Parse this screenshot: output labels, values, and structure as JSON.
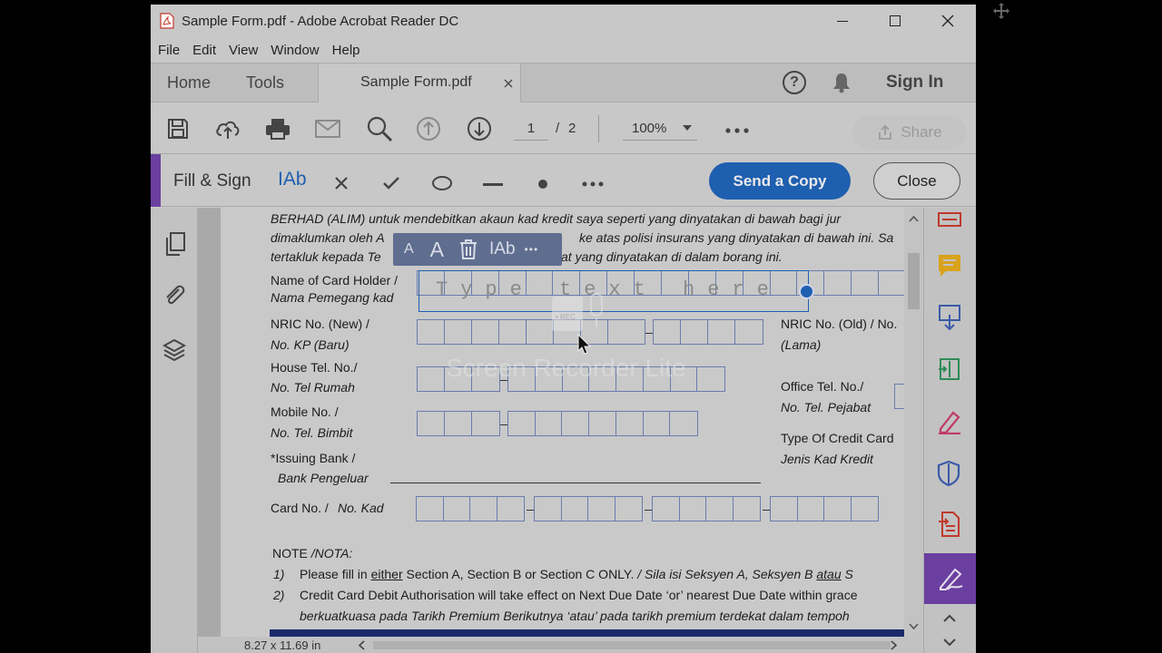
{
  "window": {
    "title": "Sample Form.pdf - Adobe Acrobat Reader DC"
  },
  "menu": [
    "File",
    "Edit",
    "View",
    "Window",
    "Help"
  ],
  "tabs": {
    "home": "Home",
    "tools": "Tools",
    "doc": "Sample Form.pdf",
    "sign_in": "Sign In"
  },
  "toolbar": {
    "page_current": "1",
    "page_sep": "/",
    "page_total": "2",
    "zoom": "100%",
    "share": "Share"
  },
  "fill_sign": {
    "label": "Fill & Sign",
    "text_tool": "IAb",
    "send_copy": "Send a Copy",
    "close": "Close"
  },
  "float_toolbar": {
    "small_a": "A",
    "big_a": "A",
    "text_tool": "IAb",
    "more": "•••"
  },
  "type_field": {
    "placeholder": "Type text here"
  },
  "watermark": {
    "text": "Screen Recorder Lite",
    "badge": "• REC"
  },
  "status": {
    "page_size": "8.27 x 11.69 in"
  },
  "doc": {
    "para_line1": "BERHAD (ALIM) untuk mendebitkan akaun kad kredit saya seperti yang dinyatakan di bawah bagi jur",
    "para_line2a": "dimaklumkan oleh A",
    "para_line2b": "ke atas polisi insurans yang dinyatakan di bawah ini. Sa",
    "para_line3a": "tertakluk kepada Te",
    "para_line3b": "at yang dinyatakan di dalam borang ini.",
    "name_label": "Name  of  Card Holder  /",
    "name_label_my": "Nama Pemegang kad",
    "nric_new": "NRIC No. (New) /",
    "nric_new_my": "No. KP (Baru)",
    "nric_old": "NRIC No. (Old) / No.",
    "nric_old_my": "(Lama)",
    "house_tel": "House Tel. No./",
    "house_tel_my": "No. Tel Rumah",
    "office_tel": "Office Tel. No./",
    "office_tel_my": "No. Tel. Pejabat",
    "mobile": "Mobile No. /",
    "mobile_my": "No. Tel. Bimbit",
    "card_type": "Type Of Credit Card",
    "card_type_my": "Jenis Kad Kredit",
    "issuing_bank": "*Issuing Bank /",
    "issuing_bank_my": "Bank Pengeluar",
    "card_no": "Card No. /",
    "card_no_my": "No. Kad",
    "note": "NOTE",
    "note_my": " /NOTA:",
    "n1_num": "1)",
    "n1_a": "Please fill in ",
    "n1_b": "either",
    "n1_c": " Section A, Section B or Section C ONLY.",
    "n1_d": " / Sila isi Seksyen A, Seksyen B ",
    "n1_e": "atau",
    "n1_f": " S",
    "n2_num": "2)",
    "n2_a": "Credit Card Debit Authorisation will take effect on Next Due Date ‘or’ nearest Due Date within grace",
    "n2_b": "berkuatkuasa pada Tarikh Premium Berikutnya ‘atau’ pada tarikh premium terdekat dalam tempoh"
  },
  "colors": {
    "accent_blue": "#1f5fb0",
    "fill_sign_purple": "#6b3fa0",
    "form_border": "#6a7cae"
  }
}
